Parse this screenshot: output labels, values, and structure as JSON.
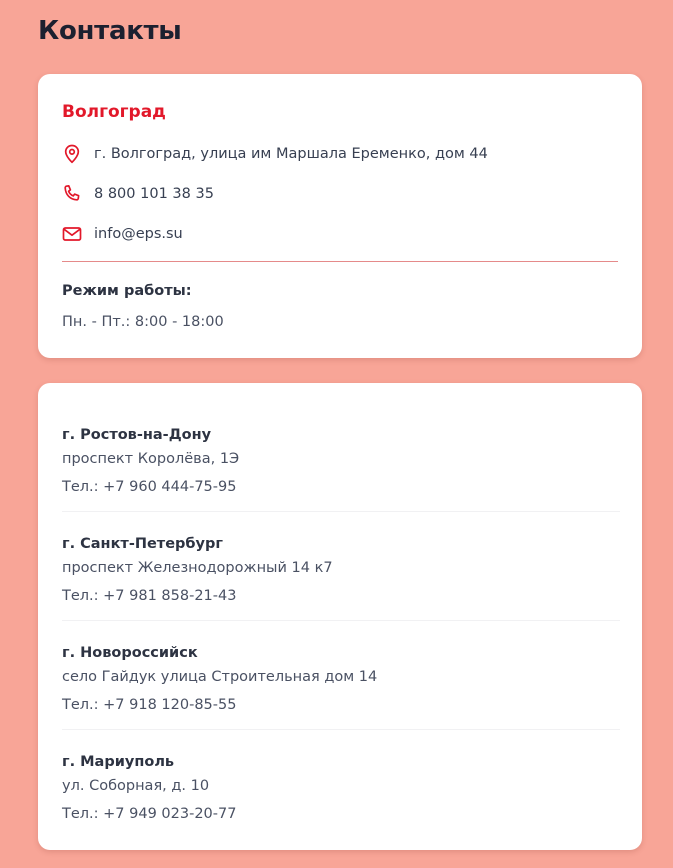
{
  "page": {
    "title": "Контакты"
  },
  "main_office": {
    "city": "Волгоград",
    "address": "г. Волгоград, улица им Маршала Еременко, дом 44",
    "phone": "8 800 101 38 35",
    "email": "info@eps.su",
    "hours_label": "Режим работы:",
    "hours_value": "Пн. - Пт.: 8:00 - 18:00",
    "icons": [
      "map-pin-icon",
      "phone-icon",
      "mail-icon"
    ]
  },
  "branches": [
    {
      "city": "г. Ростов-на-Дону",
      "address": "проспект Королёва, 1Э",
      "phone": "Тел.: +7 960 444-75-95"
    },
    {
      "city": "г. Санкт-Петербург",
      "address": "проспект Железнодорожный 14 к7",
      "phone": "Тел.: +7 981 858-21-43"
    },
    {
      "city": "г. Новороссийск",
      "address": "село Гайдук улица Строительная дом 14",
      "phone": "Тел.: +7 918 120-85-55"
    },
    {
      "city": "г. Мариуполь",
      "address": "ул. Соборная, д. 10",
      "phone": "Тел.: +7 949 023-20-77"
    }
  ],
  "colors": {
    "background": "#f8a597",
    "accent": "#e2182a",
    "card": "#ffffff"
  }
}
